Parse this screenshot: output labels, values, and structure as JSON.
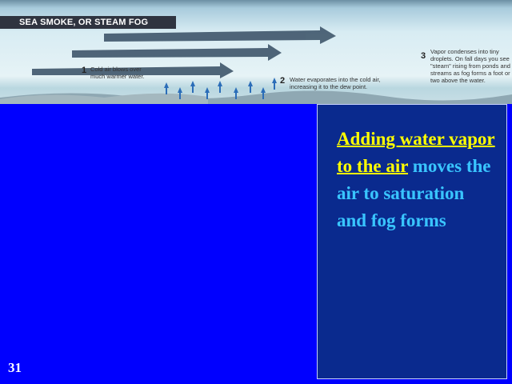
{
  "banner": {
    "title": "SEA SMOKE, OR STEAM FOG",
    "steps": [
      {
        "num": "1",
        "text": "Cold air blows over much warmer water."
      },
      {
        "num": "2",
        "text": "Water evaporates into the cold air, increasing it to the dew point."
      },
      {
        "num": "3",
        "text": "Vapor condenses into tiny droplets. On fall days you see \"steam\" rising from ponds and streams as fog forms a foot or two above the water."
      }
    ]
  },
  "panel": {
    "highlight": "Adding water vapor to the air",
    "rest": " moves the air to saturation and fog forms"
  },
  "slide_number": "31",
  "colors": {
    "background": "#0000ff",
    "panel": "#0a2a8e",
    "highlight": "#ffff00",
    "text": "#39c5ff"
  }
}
